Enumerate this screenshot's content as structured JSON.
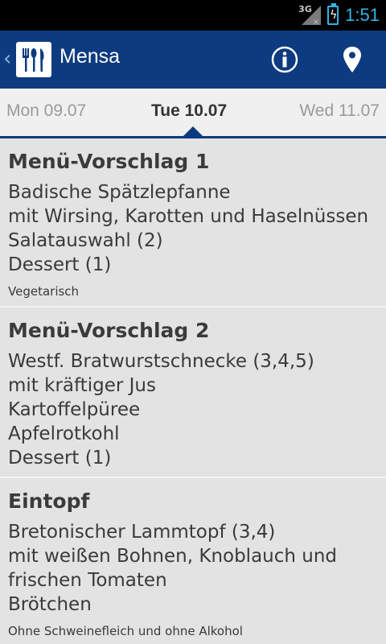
{
  "status": {
    "network": "3G",
    "time": "1:51"
  },
  "actionbar": {
    "title": "Mensa",
    "info_icon": "info-icon",
    "map_icon": "location-pin-icon"
  },
  "tabs": {
    "prev": "Mon 09.07",
    "current": "Tue 10.07",
    "next": "Wed 11.07"
  },
  "meals": [
    {
      "title": "Menü-Vorschlag 1",
      "lines": [
        "Badische Spätzlepfanne",
        "mit Wirsing, Karotten und Haselnüssen",
        "Salatauswahl (2)",
        "Dessert (1)"
      ],
      "note": "Vegetarisch"
    },
    {
      "title": "Menü-Vorschlag 2",
      "lines": [
        "Westf. Bratwurstschnecke (3,4,5)",
        "mit kräftiger Jus",
        "Kartoffelpüree",
        "Apfelrotkohl",
        "Dessert (1)"
      ],
      "note": ""
    },
    {
      "title": "Eintopf",
      "lines": [
        "Bretonischer Lammtopf (3,4)",
        "mit weißen Bohnen, Knoblauch und",
        "frischen Tomaten",
        "Brötchen"
      ],
      "note": "Ohne Schweinefleich und ohne Alkohol"
    }
  ],
  "colors": {
    "actionbar": "#0d3b7f",
    "accent": "#33b5e5",
    "background": "#e3e3e3"
  }
}
